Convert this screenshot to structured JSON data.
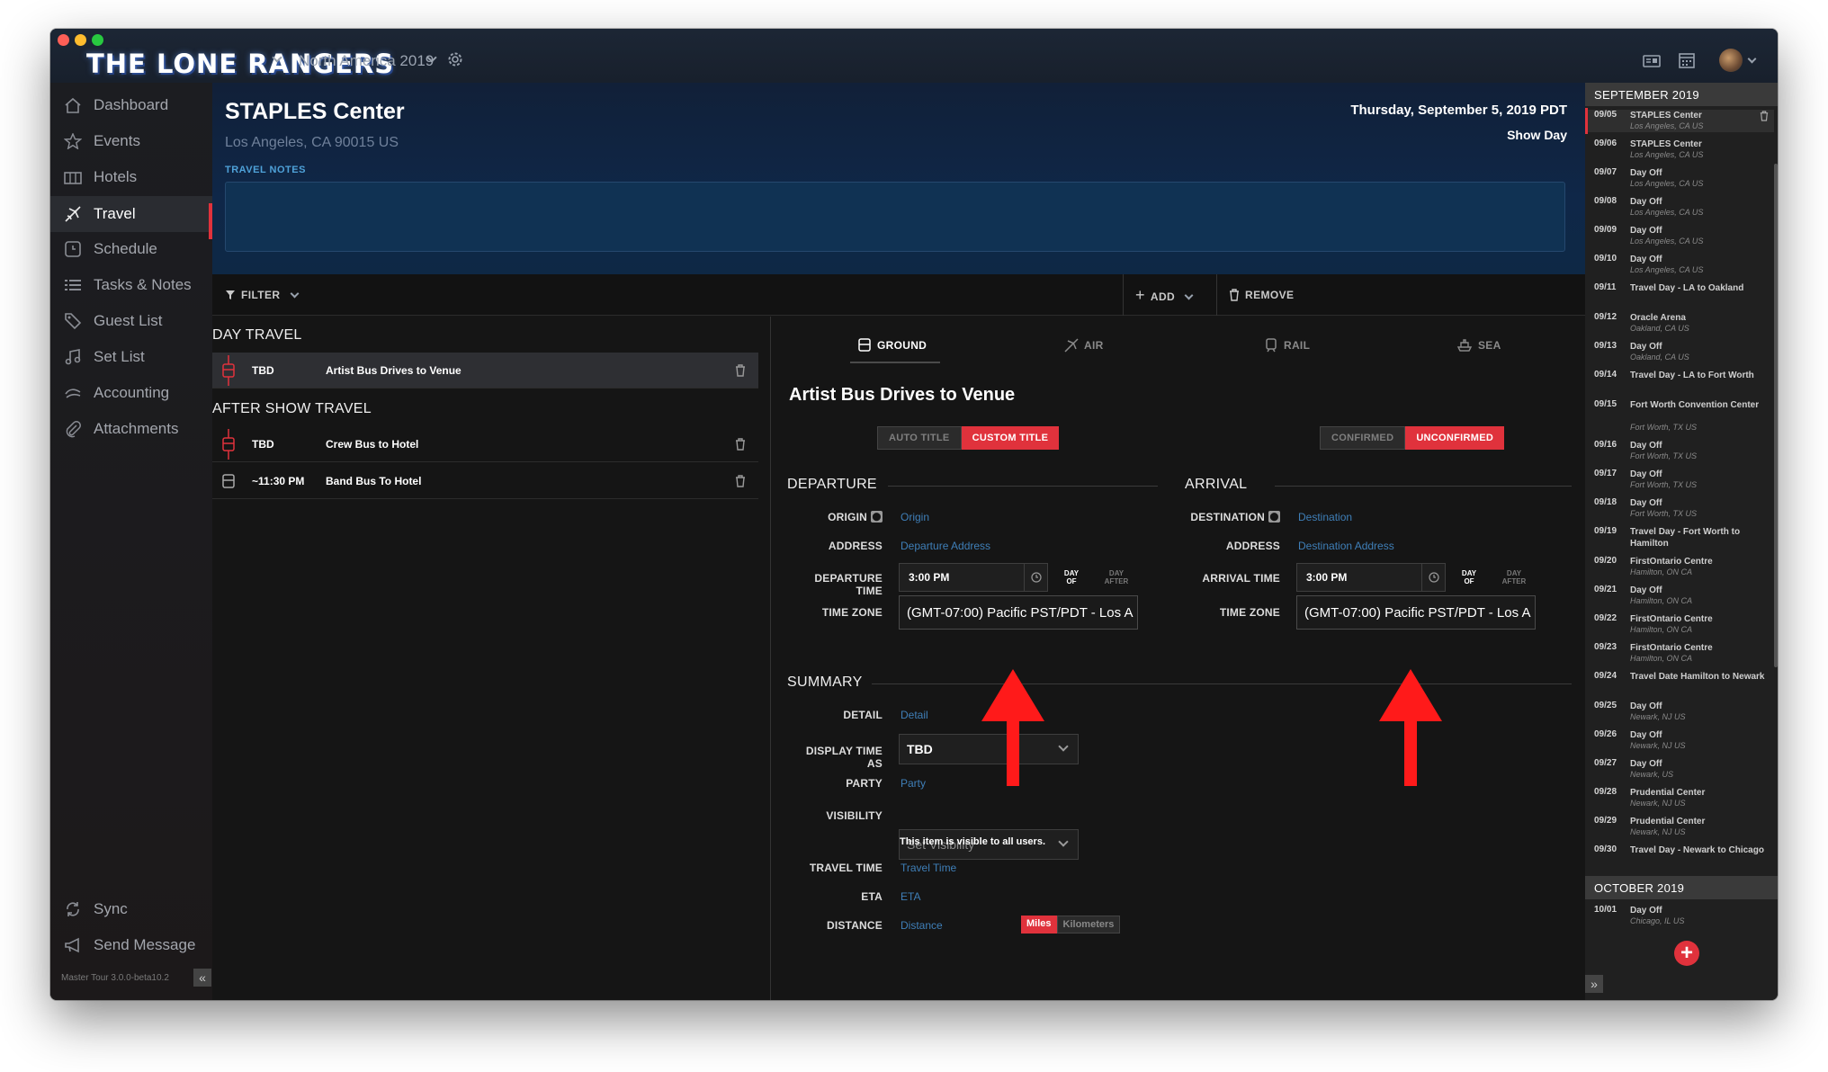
{
  "app": {
    "band_name": "THE LONE RANGERS",
    "tour_name": "North America 2019",
    "version": "Master Tour 3.0.0-beta10.2"
  },
  "sidebar": {
    "items": [
      {
        "label": "Dashboard",
        "icon": "home-icon"
      },
      {
        "label": "Events",
        "icon": "star-icon"
      },
      {
        "label": "Hotels",
        "icon": "hotel-icon"
      },
      {
        "label": "Travel",
        "icon": "plane-icon",
        "active": true
      },
      {
        "label": "Schedule",
        "icon": "clock-icon"
      },
      {
        "label": "Tasks & Notes",
        "icon": "list-icon"
      },
      {
        "label": "Guest List",
        "icon": "ticket-icon"
      },
      {
        "label": "Set List",
        "icon": "music-icon"
      },
      {
        "label": "Accounting",
        "icon": "accounting-icon"
      },
      {
        "label": "Attachments",
        "icon": "paperclip-icon"
      }
    ],
    "sync_label": "Sync",
    "send_message_label": "Send Message"
  },
  "header": {
    "venue": "STAPLES Center",
    "address": "Los Angeles, CA 90015 US",
    "travel_notes_label": "TRAVEL NOTES",
    "date": "Thursday, September 5, 2019 PDT",
    "day_type": "Show Day"
  },
  "toolbar": {
    "filter_label": "FILTER",
    "add_label": "ADD",
    "remove_label": "REMOVE"
  },
  "travel_list": {
    "day_travel_label": "DAY TRAVEL",
    "after_show_label": "AFTER SHOW TRAVEL",
    "day_travel": [
      {
        "time": "TBD",
        "name": "Artist Bus Drives to Venue"
      }
    ],
    "after_show": [
      {
        "time": "TBD",
        "name": "Crew Bus to Hotel"
      },
      {
        "time": "~11:30 PM",
        "name": "Band Bus To Hotel"
      }
    ]
  },
  "detail": {
    "modes": [
      "GROUND",
      "AIR",
      "RAIL",
      "SEA"
    ],
    "active_mode": "GROUND",
    "title": "Artist Bus Drives to Venue",
    "auto_title_label": "AUTO TITLE",
    "custom_title_label": "CUSTOM TITLE",
    "confirmed_label": "CONFIRMED",
    "unconfirmed_label": "UNCONFIRMED",
    "departure": {
      "section_label": "DEPARTURE",
      "origin_label": "ORIGIN",
      "origin_placeholder": "Origin",
      "address_label": "ADDRESS",
      "address_placeholder": "Departure Address",
      "time_label": "DEPARTURE TIME",
      "time_value": "3:00 PM",
      "day_of_label": "DAY OF",
      "day_after_label": "DAY AFTER",
      "tz_label": "TIME ZONE",
      "tz_value": "(GMT-07:00) Pacific PST/PDT - Los A"
    },
    "arrival": {
      "section_label": "ARRIVAL",
      "dest_label": "DESTINATION",
      "dest_placeholder": "Destination",
      "address_label": "ADDRESS",
      "address_placeholder": "Destination Address",
      "time_label": "ARRIVAL TIME",
      "time_value": "3:00 PM",
      "day_of_label": "DAY OF",
      "day_after_label": "DAY AFTER",
      "tz_label": "TIME ZONE",
      "tz_value": "(GMT-07:00) Pacific PST/PDT - Los A"
    },
    "summary": {
      "section_label": "SUMMARY",
      "detail_label": "DETAIL",
      "detail_placeholder": "Detail",
      "display_time_label": "DISPLAY TIME AS",
      "display_time_value": "TBD",
      "party_label": "PARTY",
      "party_placeholder": "Party",
      "visibility_label": "VISIBILITY",
      "visibility_placeholder": "Set Visibility",
      "visibility_note": "This item is visible to all users.",
      "travel_time_label": "TRAVEL TIME",
      "travel_time_placeholder": "Travel Time",
      "eta_label": "ETA",
      "eta_placeholder": "ETA",
      "distance_label": "DISTANCE",
      "distance_placeholder": "Distance",
      "miles_label": "Miles",
      "km_label": "Kilometers"
    }
  },
  "calendar": {
    "sep_label": "SEPTEMBER 2019",
    "oct_label": "OCTOBER 2019",
    "sep": [
      {
        "date": "09/05",
        "title": "STAPLES Center",
        "sub": "Los Angeles, CA US"
      },
      {
        "date": "09/06",
        "title": "STAPLES Center",
        "sub": "Los Angeles, CA US"
      },
      {
        "date": "09/07",
        "title": "Day Off",
        "sub": "Los Angeles, CA US"
      },
      {
        "date": "09/08",
        "title": "Day Off",
        "sub": "Los Angeles, CA US"
      },
      {
        "date": "09/09",
        "title": "Day Off",
        "sub": "Los Angeles, CA US"
      },
      {
        "date": "09/10",
        "title": "Day Off",
        "sub": "Los Angeles, CA US"
      },
      {
        "date": "09/11",
        "title": "Travel Day - LA to Oakland",
        "sub": ""
      },
      {
        "date": "09/12",
        "title": "Oracle Arena",
        "sub": "Oakland, CA US"
      },
      {
        "date": "09/13",
        "title": "Day Off",
        "sub": "Oakland, CA US"
      },
      {
        "date": "09/14",
        "title": "Travel Day - LA to Fort Worth",
        "sub": ""
      },
      {
        "date": "09/15",
        "title": "Fort Worth Convention Center",
        "sub": "Fort Worth, TX US"
      },
      {
        "date": "09/16",
        "title": "Day Off",
        "sub": "Fort Worth, TX US"
      },
      {
        "date": "09/17",
        "title": "Day Off",
        "sub": "Fort Worth, TX US"
      },
      {
        "date": "09/18",
        "title": "Day Off",
        "sub": "Fort Worth, TX US"
      },
      {
        "date": "09/19",
        "title": "Travel Day - Fort Worth to Hamilton",
        "sub": ""
      },
      {
        "date": "09/20",
        "title": "FirstOntario Centre",
        "sub": "Hamilton, ON CA"
      },
      {
        "date": "09/21",
        "title": "Day Off",
        "sub": "Hamilton, ON CA"
      },
      {
        "date": "09/22",
        "title": "FirstOntario Centre",
        "sub": "Hamilton, ON CA"
      },
      {
        "date": "09/23",
        "title": "FirstOntario Centre",
        "sub": "Hamilton, ON CA"
      },
      {
        "date": "09/24",
        "title": "Travel Date Hamilton to Newark",
        "sub": ""
      },
      {
        "date": "09/25",
        "title": "Day Off",
        "sub": "Newark, NJ US"
      },
      {
        "date": "09/26",
        "title": "Day Off",
        "sub": "Newark, NJ US"
      },
      {
        "date": "09/27",
        "title": "Day Off",
        "sub": "Newark, US"
      },
      {
        "date": "09/28",
        "title": "Prudential Center",
        "sub": "Newark, NJ US"
      },
      {
        "date": "09/29",
        "title": "Prudential Center",
        "sub": "Newark, NJ US"
      },
      {
        "date": "09/30",
        "title": "Travel Day - Newark to Chicago",
        "sub": ""
      }
    ],
    "oct": [
      {
        "date": "10/01",
        "title": "Day Off",
        "sub": "Chicago, IL US"
      }
    ]
  },
  "colors": {
    "accent": "#e0323c",
    "link": "#3f7fb8",
    "header_bg": "#0f2748",
    "annotation_arrow": "#ff1a1a"
  }
}
